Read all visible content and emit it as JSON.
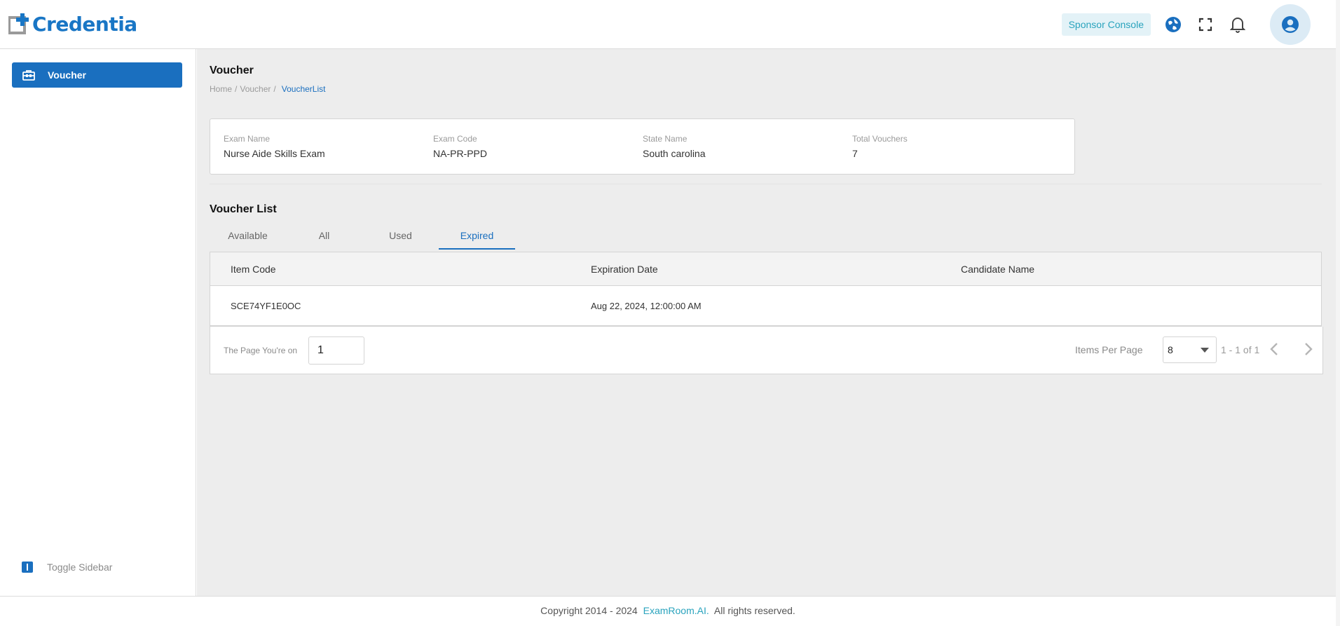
{
  "header": {
    "logo_text": "Credentia",
    "sponsor_console": "Sponsor Console",
    "icons": [
      "globe-icon",
      "fullscreen-icon",
      "bell-icon",
      "account-circle-icon"
    ]
  },
  "sidebar": {
    "items": [
      {
        "label": "Voucher",
        "icon": "voucher-icon"
      }
    ],
    "toggle_label": "Toggle Sidebar"
  },
  "page": {
    "title": "Voucher",
    "breadcrumb": [
      "Home",
      "Voucher",
      "VoucherList"
    ]
  },
  "info": {
    "exam_name_label": "Exam Name",
    "exam_name": "Nurse Aide Skills Exam",
    "exam_code_label": "Exam Code",
    "exam_code": "NA-PR-PPD",
    "state_name_label": "State Name",
    "state_name": "South carolina",
    "total_vouchers_label": "Total Vouchers",
    "total_vouchers": "7"
  },
  "voucher_list": {
    "title": "Voucher List",
    "tabs": [
      "Available",
      "All",
      "Used",
      "Expired"
    ],
    "active_tab": "Expired",
    "columns": [
      "Item Code",
      "Expiration Date",
      "Candidate Name"
    ],
    "rows": [
      {
        "item_code": "SCE74YF1E0OC",
        "expiration_date": "Aug 22, 2024, 12:00:00 AM",
        "candidate_name": ""
      }
    ]
  },
  "pagination": {
    "page_label": "The Page You're on",
    "page_value": "1",
    "items_per_page_label": "Items Per Page",
    "items_per_page": "8",
    "range": "1 - 1 of 1"
  },
  "footer": {
    "prefix": "Copyright 2014 - 2024",
    "brand": "ExamRoom.AI.",
    "suffix": "All rights reserved."
  },
  "colors": {
    "primary": "#1a6fbf",
    "accent": "#29a3bd",
    "background": "#ededed"
  }
}
